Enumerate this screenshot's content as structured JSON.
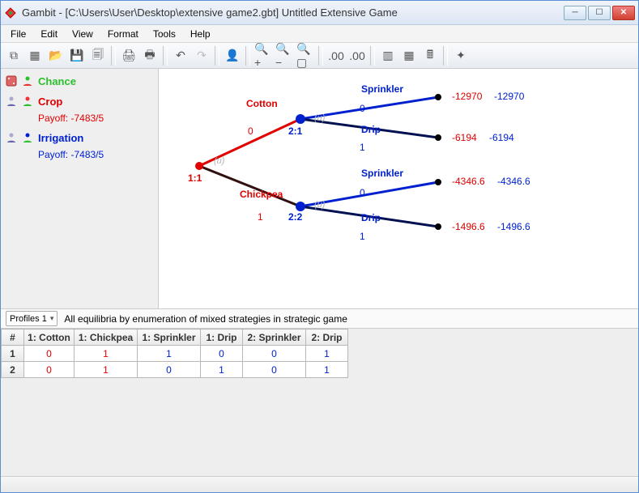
{
  "window": {
    "title": "Gambit - [C:\\Users\\User\\Desktop\\extensive game2.gbt] Untitled Extensive Game"
  },
  "menu": {
    "items": [
      "File",
      "Edit",
      "View",
      "Format",
      "Tools",
      "Help"
    ]
  },
  "toolbar": {
    "buttons": [
      {
        "name": "new-tree",
        "glyph": "⧉"
      },
      {
        "name": "new-table",
        "glyph": "▦"
      },
      {
        "name": "open",
        "glyph": "📂"
      },
      {
        "name": "save",
        "glyph": "💾"
      },
      {
        "name": "save-as",
        "glyph": "🗐"
      },
      {
        "sep": true
      },
      {
        "name": "print",
        "glyph": "🖨"
      },
      {
        "name": "print-preview",
        "glyph": "🖶"
      },
      {
        "sep": true
      },
      {
        "name": "undo",
        "glyph": "↶",
        "disabled": false
      },
      {
        "name": "redo",
        "glyph": "↷",
        "disabled": true
      },
      {
        "sep": true
      },
      {
        "name": "add-player",
        "glyph": "👤"
      },
      {
        "sep": true
      },
      {
        "name": "zoom-in",
        "glyph": "🔍+"
      },
      {
        "name": "zoom-out",
        "glyph": "🔍−"
      },
      {
        "name": "zoom-fit",
        "glyph": "🔍▢"
      },
      {
        "sep": true
      },
      {
        "name": "decimals-less",
        "glyph": ".00"
      },
      {
        "name": "decimals-more",
        "glyph": ".00"
      },
      {
        "sep": true
      },
      {
        "name": "layout-1",
        "glyph": "▥"
      },
      {
        "name": "layout-2",
        "glyph": "▦"
      },
      {
        "name": "calculator",
        "glyph": "🖩"
      },
      {
        "sep": true
      },
      {
        "name": "arrange",
        "glyph": "✦"
      }
    ]
  },
  "sidebar": {
    "players": [
      {
        "name": "Chance",
        "color": "green",
        "payoff": ""
      },
      {
        "name": "Crop",
        "color": "red",
        "payoff": "Payoff: -7483/5"
      },
      {
        "name": "Irrigation",
        "color": "blue",
        "payoff": "Payoff: -7483/5"
      }
    ]
  },
  "tree": {
    "root": {
      "id": "1:1",
      "u": "(u)"
    },
    "branches": {
      "top": {
        "label": "Cotton",
        "p": "0",
        "node": "2:1",
        "u": "(u)",
        "leaves": [
          {
            "label": "Sprinkler",
            "p": "0",
            "pay": [
              "-12970",
              "-12970"
            ]
          },
          {
            "label": "Drip",
            "p": "1",
            "pay": [
              "-6194",
              "-6194"
            ]
          }
        ]
      },
      "bot": {
        "label": "Chickpea",
        "p": "1",
        "node": "2:2",
        "u": "(u)",
        "leaves": [
          {
            "label": "Sprinkler",
            "p": "0",
            "pay": [
              "-4346.6",
              "-4346.6"
            ]
          },
          {
            "label": "Drip",
            "p": "1",
            "pay": [
              "-1496.6",
              "-1496.6"
            ]
          }
        ]
      }
    }
  },
  "profiles": {
    "selector": "Profiles 1",
    "description": "All equilibria by enumeration of mixed strategies in strategic game",
    "columns": [
      "#",
      "1: Cotton",
      "1: Chickpea",
      "1: Sprinkler",
      "1: Drip",
      "2: Sprinkler",
      "2: Drip"
    ],
    "rows": [
      {
        "n": "1",
        "v": [
          "0",
          "1",
          "1",
          "0",
          "0",
          "1"
        ]
      },
      {
        "n": "2",
        "v": [
          "0",
          "1",
          "0",
          "1",
          "0",
          "1"
        ]
      }
    ]
  }
}
